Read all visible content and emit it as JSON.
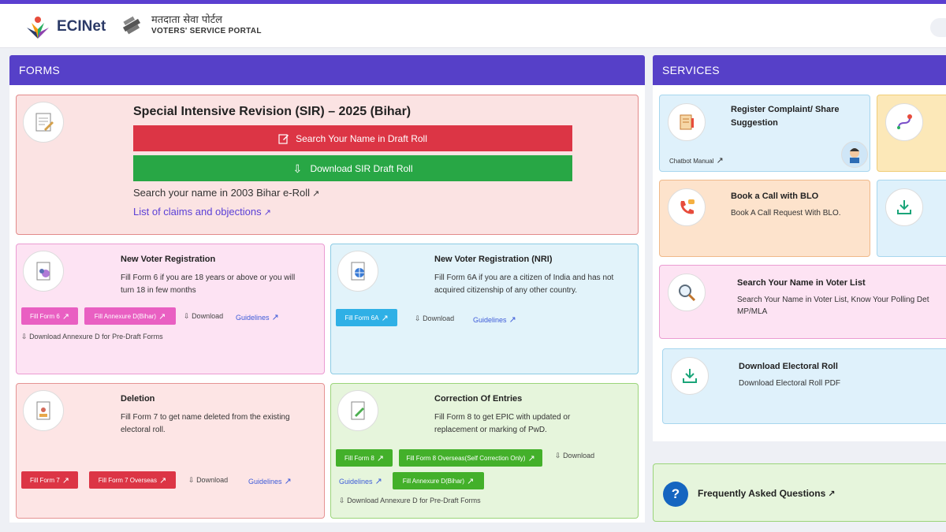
{
  "header": {
    "brand": "ECINet",
    "portal_hindi": "मतदाता सेवा पोर्टल",
    "portal_english": "VOTERS' SERVICE PORTAL"
  },
  "forms_panel": {
    "heading": "FORMS",
    "sir": {
      "title": "Special Intensive Revision (SIR) – 2025 (Bihar)",
      "search_button": "Search Your Name in Draft Roll",
      "download_button": "Download SIR Draft Roll",
      "eroll_link": "Search your name in 2003 Bihar e-Roll",
      "claims_link": "List of claims and objections"
    },
    "new_voter": {
      "title": "New Voter Registration",
      "desc": "Fill Form 6 if you are 18 years or above or you will turn 18 in few months",
      "btn_form6": "Fill Form 6",
      "btn_annexure": "Fill Annexure D(Bihar)",
      "download": "Download",
      "guidelines": "Guidelines",
      "annexure_link": "Download Annexure D for Pre-Draft Forms"
    },
    "nri": {
      "title": "New Voter Registration (NRI)",
      "desc": "Fill Form 6A if you are a citizen of India and has not acquired citizenship of any other country.",
      "btn_form6a": "Fill Form 6A",
      "download": "Download",
      "guidelines": "Guidelines"
    },
    "deletion": {
      "title": "Deletion",
      "desc": "Fill Form 7 to get name deleted from the existing electoral roll.",
      "btn_form7": "Fill Form 7",
      "btn_form7_overseas": "Fill Form 7 Overseas",
      "download": "Download",
      "guidelines": "Guidelines"
    },
    "correction": {
      "title": "Correction Of Entries",
      "desc": "Fill Form 8 to get EPIC with updated or replacement or marking of PwD.",
      "btn_form8": "Fill Form 8",
      "btn_form8_overseas": "Fill Form 8 Overseas(Self Correction Only)",
      "download": "Download",
      "guidelines": "Guidelines",
      "btn_annexure": "Fill Annexure D(Bihar)",
      "annexure_link": "Download Annexure D for Pre-Draft Forms"
    }
  },
  "services_panel": {
    "heading": "SERVICES",
    "complaint": {
      "title": "Register Complaint/ Share Suggestion",
      "chatbot": "Chatbot Manual"
    },
    "blo": {
      "title": "Book a Call with BLO",
      "desc": "Book A Call Request With BLO."
    },
    "search": {
      "title": "Search Your Name in Voter List",
      "desc": "Search Your Name in Voter List, Know Your Polling Det MP/MLA"
    },
    "roll": {
      "title": "Download Electoral Roll",
      "desc": "Download Electoral Roll PDF"
    },
    "faq": {
      "text": "Frequently Asked Questions"
    }
  },
  "colors": {
    "accent": "#5640c8",
    "red": "#dc3545",
    "green": "#28a745",
    "pink_button": "#e95fc2",
    "blue_button": "#2fb0e6"
  },
  "icons": {
    "arrow": "↗",
    "download": "⇩"
  }
}
